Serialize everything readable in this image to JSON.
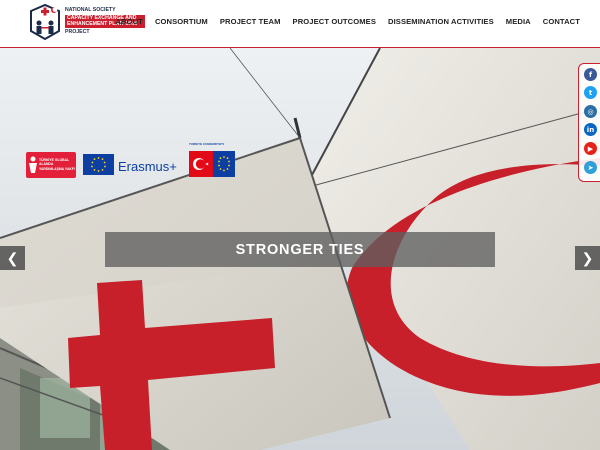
{
  "header": {
    "logo": {
      "line1": "NATIONAL SOCIETY",
      "line2": "CAPACITY EXCHANGE AND ENHANCEMENT PLATFORM",
      "line3": "PROJECT"
    },
    "nav": [
      {
        "label": "ABOUT"
      },
      {
        "label": "CONSORTIUM"
      },
      {
        "label": "PROJECT TEAM"
      },
      {
        "label": "PROJECT OUTCOMES"
      },
      {
        "label": "DISSEMINATION ACTIVITIES"
      },
      {
        "label": "MEDIA"
      },
      {
        "label": "CONTACT"
      }
    ]
  },
  "hero": {
    "caption": "STRONGER TIES",
    "sponsors": {
      "left_logo_text": "TÜRKİYE GLOBAL ALANDA YARDIMLAŞMA VAKFI",
      "erasmus": "Erasmus+",
      "turkey_logo_text": "TÜRKİYE CUMHURİYETİ"
    },
    "prev_icon": "chevron-left-icon",
    "next_icon": "chevron-right-icon"
  },
  "social": [
    {
      "name": "facebook",
      "glyph": "f",
      "color": "#3b5998"
    },
    {
      "name": "twitter",
      "glyph": "t",
      "color": "#1da1f2"
    },
    {
      "name": "instagram",
      "glyph": "◎",
      "color": "#2a6ea5"
    },
    {
      "name": "linkedin",
      "glyph": "in",
      "color": "#0a66c2"
    },
    {
      "name": "youtube",
      "glyph": "▶",
      "color": "#e62117"
    },
    {
      "name": "telegram",
      "glyph": "➤",
      "color": "#2fa0d8"
    }
  ],
  "colors": {
    "brand_red": "#cc1f2d",
    "brand_navy": "#1c2a4a"
  }
}
